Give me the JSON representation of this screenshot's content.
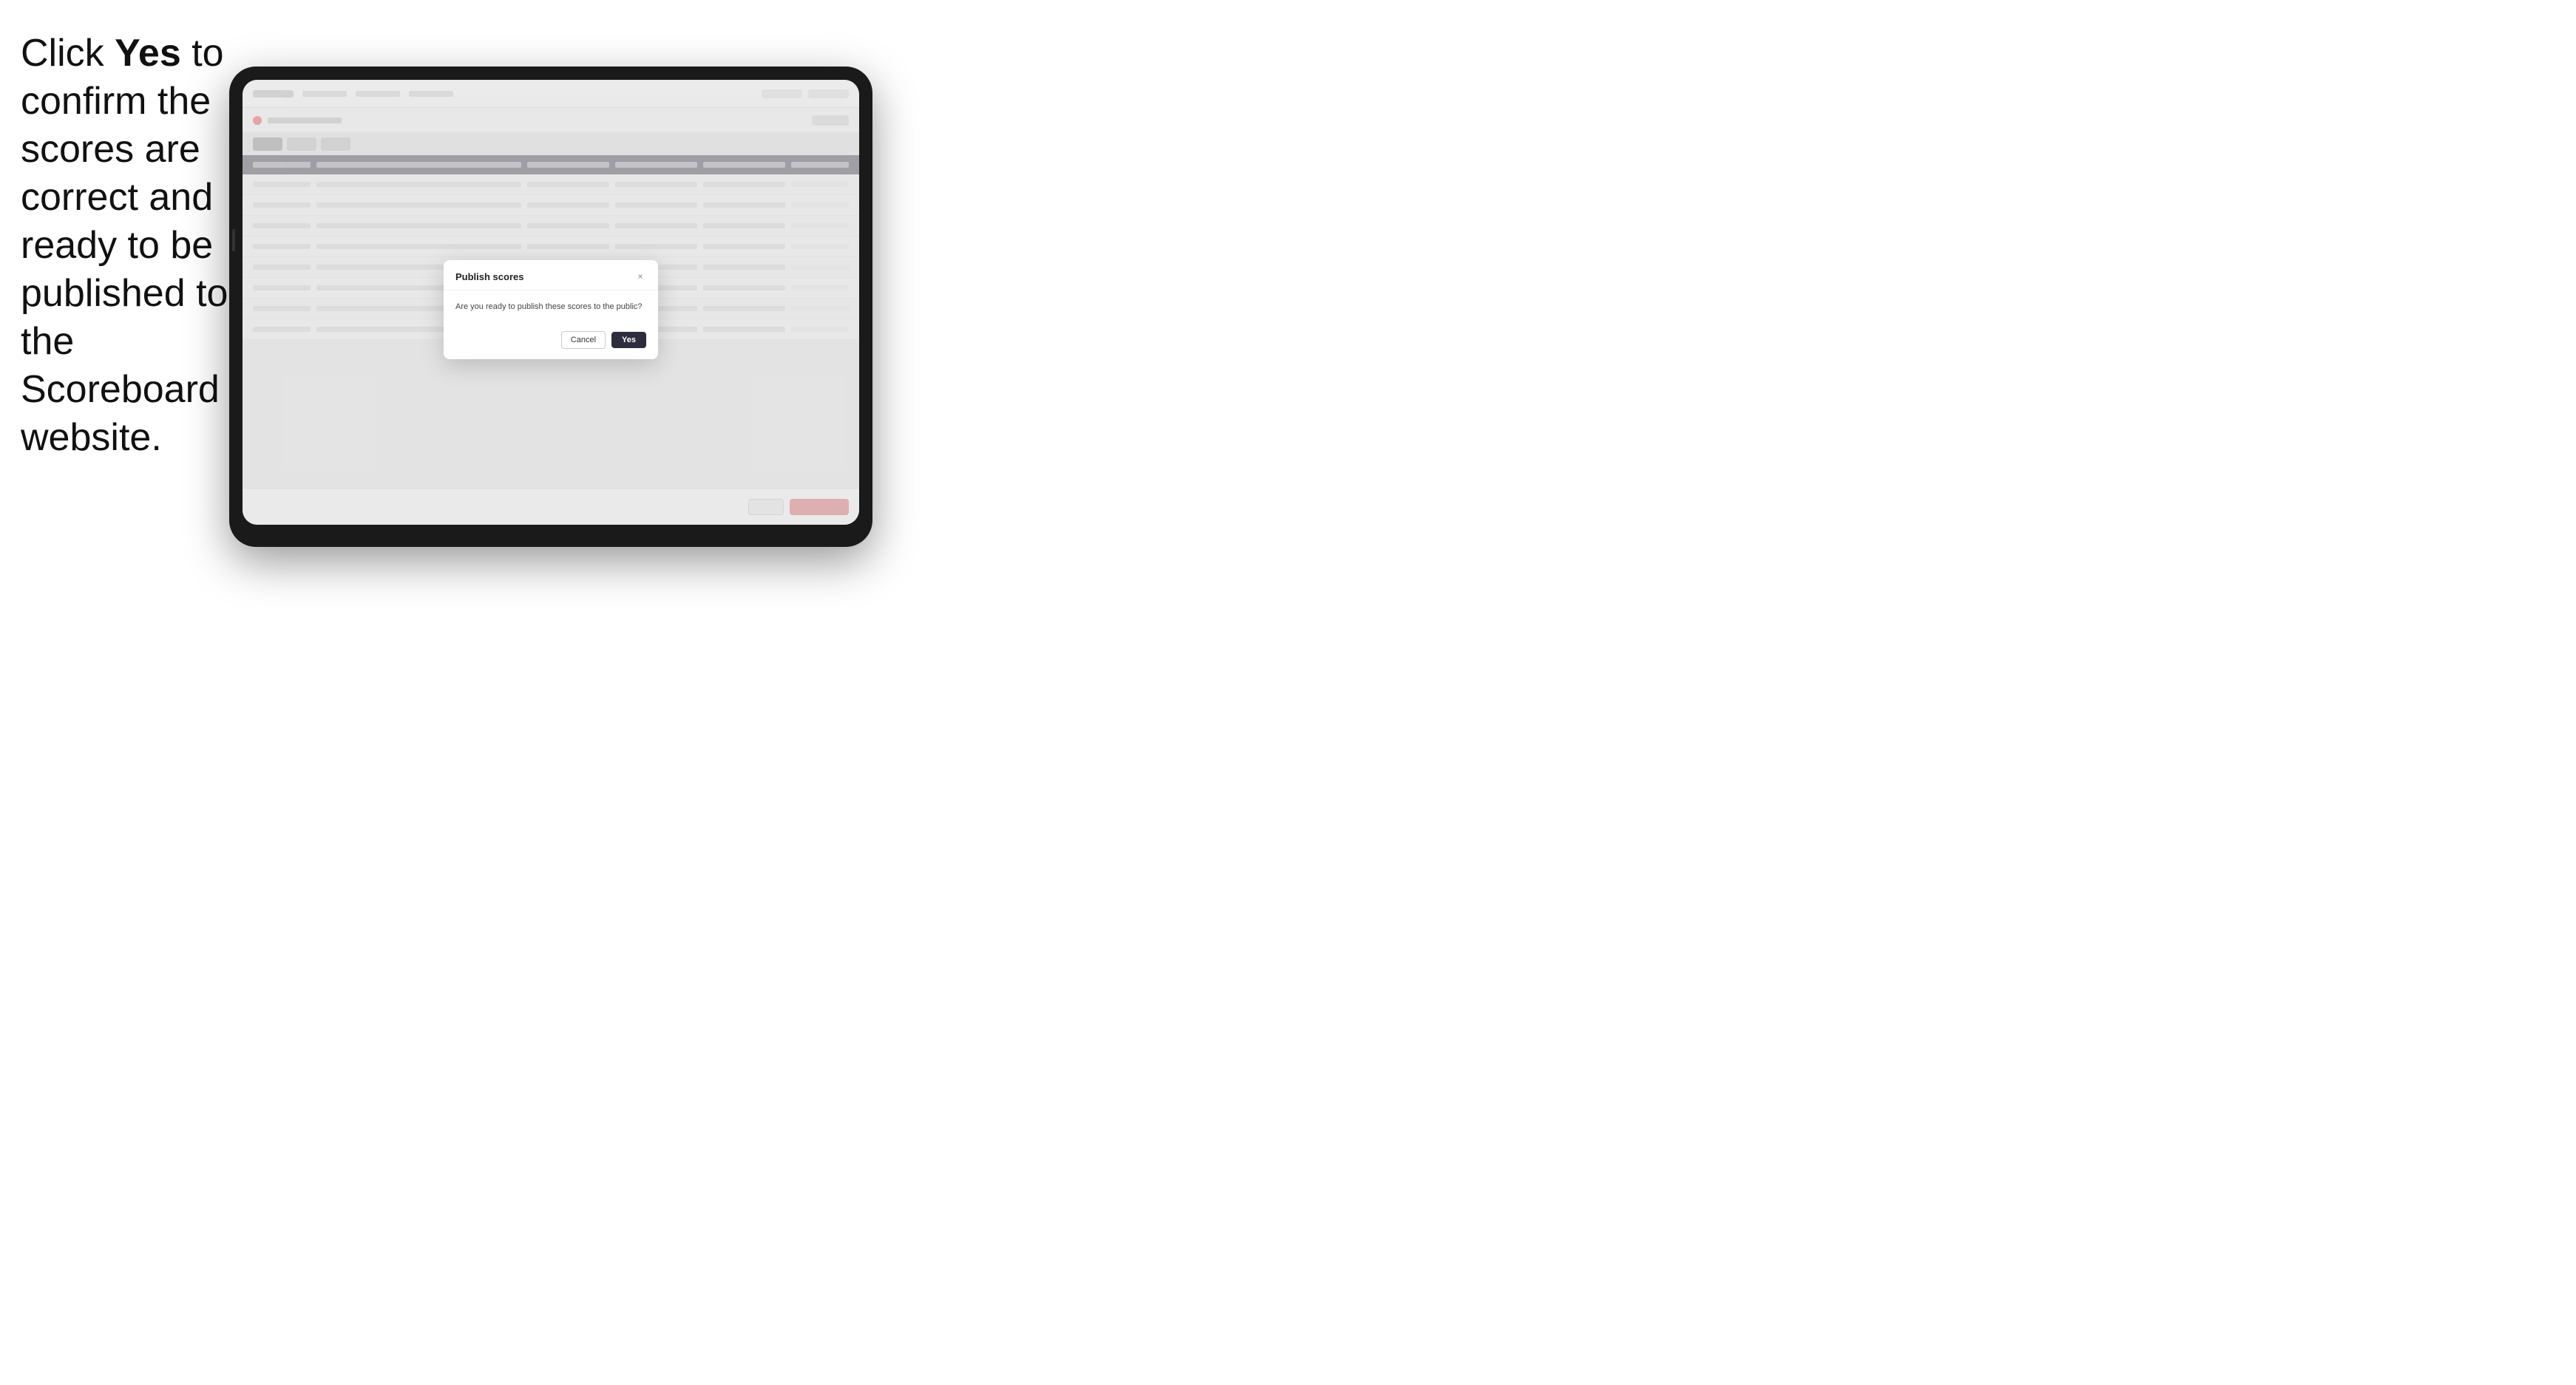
{
  "instruction": {
    "text_part1": "Click ",
    "bold_word": "Yes",
    "text_part2": " to confirm the scores are correct and ready to be published to the Scoreboard website."
  },
  "modal": {
    "title": "Publish scores",
    "message": "Are you ready to publish these scores to the public?",
    "cancel_label": "Cancel",
    "yes_label": "Yes",
    "close_icon": "×"
  },
  "table": {
    "rows": [
      {
        "col1": "",
        "col2": "",
        "col3": "",
        "col4": ""
      },
      {
        "col1": "",
        "col2": "",
        "col3": "",
        "col4": ""
      },
      {
        "col1": "",
        "col2": "",
        "col3": "",
        "col4": ""
      },
      {
        "col1": "",
        "col2": "",
        "col3": "",
        "col4": ""
      },
      {
        "col1": "",
        "col2": "",
        "col3": "",
        "col4": ""
      },
      {
        "col1": "",
        "col2": "",
        "col3": "",
        "col4": ""
      },
      {
        "col1": "",
        "col2": "",
        "col3": "",
        "col4": ""
      },
      {
        "col1": "",
        "col2": "",
        "col3": "",
        "col4": ""
      }
    ]
  }
}
